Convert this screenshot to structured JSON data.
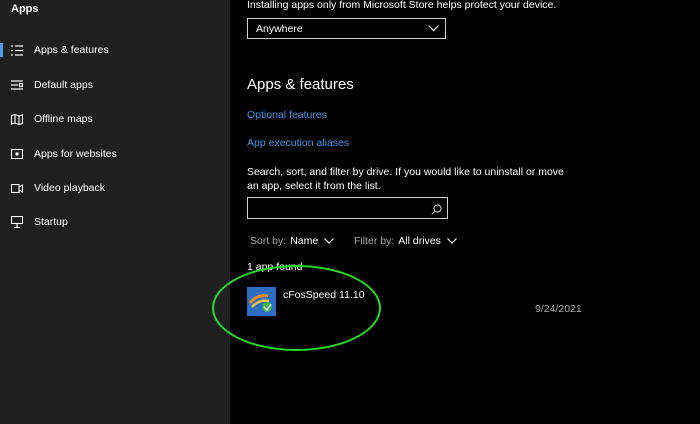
{
  "sidebar": {
    "title": "Apps",
    "items": [
      {
        "label": "Apps & features",
        "icon": "apps-list-icon",
        "selected": true
      },
      {
        "label": "Default apps",
        "icon": "default-apps-icon"
      },
      {
        "label": "Offline maps",
        "icon": "map-icon"
      },
      {
        "label": "Apps for websites",
        "icon": "apps-for-websites-icon"
      },
      {
        "label": "Video playback",
        "icon": "video-icon"
      },
      {
        "label": "Startup",
        "icon": "startup-icon"
      }
    ]
  },
  "main": {
    "top_note": "Installing apps only from Microsoft Store helps protect your device.",
    "source_dropdown": {
      "value": "Anywhere"
    },
    "section_title": "Apps & features",
    "links": {
      "optional_features": "Optional features",
      "execution_aliases": "App execution aliases"
    },
    "description": "Search, sort, and filter by drive. If you would like to uninstall or move an app, select it from the list.",
    "search": {
      "value": "",
      "placeholder": ""
    },
    "sort": {
      "label": "Sort by:",
      "value": "Name"
    },
    "filter": {
      "label": "Filter by:",
      "value": "All drives"
    },
    "found_text": "1 app found",
    "apps": [
      {
        "name": "cFosSpeed 11.10",
        "date": "9/24/2021",
        "icon": "cfosspeed-app-icon"
      }
    ]
  },
  "colors": {
    "accent": "#3a97ea",
    "sidebar_bg": "#1f1f1f",
    "annotation": "#22dd22"
  }
}
